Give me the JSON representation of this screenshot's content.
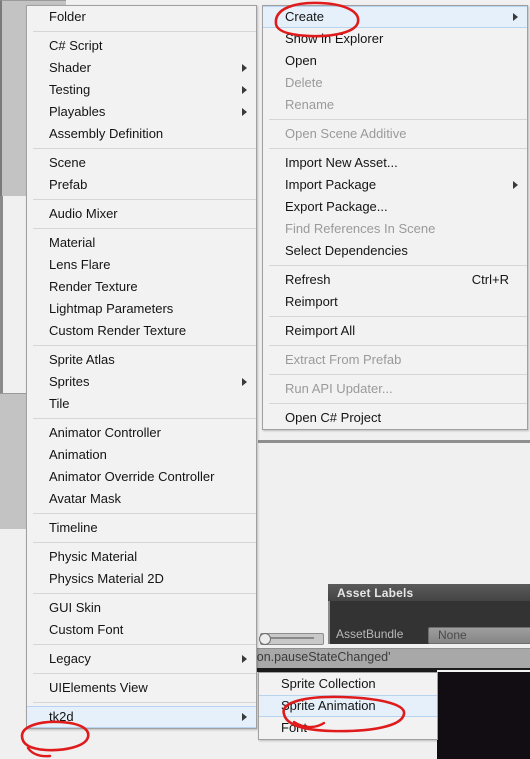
{
  "window": {
    "app": "Unity Editor",
    "context": "Project view context menu"
  },
  "left_menu": {
    "name": "Create submenu",
    "groups": [
      {
        "items": [
          {
            "label": "Folder",
            "submenu": false,
            "disabled": false,
            "selected": false
          }
        ]
      },
      {
        "items": [
          {
            "label": "C# Script",
            "submenu": false,
            "disabled": false,
            "selected": false
          },
          {
            "label": "Shader",
            "submenu": true,
            "disabled": false,
            "selected": false
          },
          {
            "label": "Testing",
            "submenu": true,
            "disabled": false,
            "selected": false
          },
          {
            "label": "Playables",
            "submenu": true,
            "disabled": false,
            "selected": false
          },
          {
            "label": "Assembly Definition",
            "submenu": false,
            "disabled": false,
            "selected": false
          }
        ]
      },
      {
        "items": [
          {
            "label": "Scene",
            "submenu": false,
            "disabled": false,
            "selected": false
          },
          {
            "label": "Prefab",
            "submenu": false,
            "disabled": false,
            "selected": false
          }
        ]
      },
      {
        "items": [
          {
            "label": "Audio Mixer",
            "submenu": false,
            "disabled": false,
            "selected": false
          }
        ]
      },
      {
        "items": [
          {
            "label": "Material",
            "submenu": false,
            "disabled": false,
            "selected": false
          },
          {
            "label": "Lens Flare",
            "submenu": false,
            "disabled": false,
            "selected": false
          },
          {
            "label": "Render Texture",
            "submenu": false,
            "disabled": false,
            "selected": false
          },
          {
            "label": "Lightmap Parameters",
            "submenu": false,
            "disabled": false,
            "selected": false
          },
          {
            "label": "Custom Render Texture",
            "submenu": false,
            "disabled": false,
            "selected": false
          }
        ]
      },
      {
        "items": [
          {
            "label": "Sprite Atlas",
            "submenu": false,
            "disabled": false,
            "selected": false
          },
          {
            "label": "Sprites",
            "submenu": true,
            "disabled": false,
            "selected": false
          },
          {
            "label": "Tile",
            "submenu": false,
            "disabled": false,
            "selected": false
          }
        ]
      },
      {
        "items": [
          {
            "label": "Animator Controller",
            "submenu": false,
            "disabled": false,
            "selected": false
          },
          {
            "label": "Animation",
            "submenu": false,
            "disabled": false,
            "selected": false
          },
          {
            "label": "Animator Override Controller",
            "submenu": false,
            "disabled": false,
            "selected": false
          },
          {
            "label": "Avatar Mask",
            "submenu": false,
            "disabled": false,
            "selected": false
          }
        ]
      },
      {
        "items": [
          {
            "label": "Timeline",
            "submenu": false,
            "disabled": false,
            "selected": false
          }
        ]
      },
      {
        "items": [
          {
            "label": "Physic Material",
            "submenu": false,
            "disabled": false,
            "selected": false
          },
          {
            "label": "Physics Material 2D",
            "submenu": false,
            "disabled": false,
            "selected": false
          }
        ]
      },
      {
        "items": [
          {
            "label": "GUI Skin",
            "submenu": false,
            "disabled": false,
            "selected": false
          },
          {
            "label": "Custom Font",
            "submenu": false,
            "disabled": false,
            "selected": false
          }
        ]
      },
      {
        "items": [
          {
            "label": "Legacy",
            "submenu": true,
            "disabled": false,
            "selected": false
          }
        ]
      },
      {
        "items": [
          {
            "label": "UIElements View",
            "submenu": false,
            "disabled": false,
            "selected": false
          }
        ]
      },
      {
        "items": [
          {
            "label": "tk2d",
            "submenu": true,
            "disabled": false,
            "selected": true
          }
        ]
      }
    ]
  },
  "right_menu": {
    "name": "Project context menu",
    "groups": [
      {
        "items": [
          {
            "label": "Create",
            "submenu": true,
            "disabled": false,
            "selected": true,
            "shortcut": ""
          },
          {
            "label": "Show in Explorer",
            "submenu": false,
            "disabled": false,
            "selected": false,
            "shortcut": ""
          },
          {
            "label": "Open",
            "submenu": false,
            "disabled": false,
            "selected": false,
            "shortcut": ""
          },
          {
            "label": "Delete",
            "submenu": false,
            "disabled": true,
            "selected": false,
            "shortcut": ""
          },
          {
            "label": "Rename",
            "submenu": false,
            "disabled": true,
            "selected": false,
            "shortcut": ""
          }
        ]
      },
      {
        "items": [
          {
            "label": "Open Scene Additive",
            "submenu": false,
            "disabled": true,
            "selected": false,
            "shortcut": ""
          }
        ]
      },
      {
        "items": [
          {
            "label": "Import New Asset...",
            "submenu": false,
            "disabled": false,
            "selected": false,
            "shortcut": ""
          },
          {
            "label": "Import Package",
            "submenu": true,
            "disabled": false,
            "selected": false,
            "shortcut": ""
          },
          {
            "label": "Export Package...",
            "submenu": false,
            "disabled": false,
            "selected": false,
            "shortcut": ""
          },
          {
            "label": "Find References In Scene",
            "submenu": false,
            "disabled": true,
            "selected": false,
            "shortcut": ""
          },
          {
            "label": "Select Dependencies",
            "submenu": false,
            "disabled": false,
            "selected": false,
            "shortcut": ""
          }
        ]
      },
      {
        "items": [
          {
            "label": "Refresh",
            "submenu": false,
            "disabled": false,
            "selected": false,
            "shortcut": "Ctrl+R"
          },
          {
            "label": "Reimport",
            "submenu": false,
            "disabled": false,
            "selected": false,
            "shortcut": ""
          }
        ]
      },
      {
        "items": [
          {
            "label": "Reimport All",
            "submenu": false,
            "disabled": false,
            "selected": false,
            "shortcut": ""
          }
        ]
      },
      {
        "items": [
          {
            "label": "Extract From Prefab",
            "submenu": false,
            "disabled": true,
            "selected": false,
            "shortcut": ""
          }
        ]
      },
      {
        "items": [
          {
            "label": "Run API Updater...",
            "submenu": false,
            "disabled": true,
            "selected": false,
            "shortcut": ""
          }
        ]
      },
      {
        "items": [
          {
            "label": "Open C# Project",
            "submenu": false,
            "disabled": false,
            "selected": false,
            "shortcut": ""
          }
        ]
      }
    ]
  },
  "tk2d_menu": {
    "name": "tk2d submenu",
    "groups": [
      {
        "items": [
          {
            "label": "Sprite Collection",
            "submenu": false,
            "disabled": false,
            "selected": false
          },
          {
            "label": "Sprite Animation",
            "submenu": false,
            "disabled": false,
            "selected": true
          },
          {
            "label": "Font",
            "submenu": false,
            "disabled": false,
            "selected": false
          }
        ]
      }
    ]
  },
  "editor_background": {
    "asset_labels_title": "Asset Labels",
    "asset_bundle_label": "AssetBundle",
    "asset_bundle_value": "None",
    "status_text": "ion.pauseStateChanged'"
  },
  "annotations": {
    "color": "#e01b1b",
    "marks": [
      {
        "target": "Create",
        "shape": "ellipse"
      },
      {
        "target": "tk2d",
        "shape": "ellipse"
      },
      {
        "target": "Sprite Animation",
        "shape": "ellipse"
      }
    ]
  }
}
